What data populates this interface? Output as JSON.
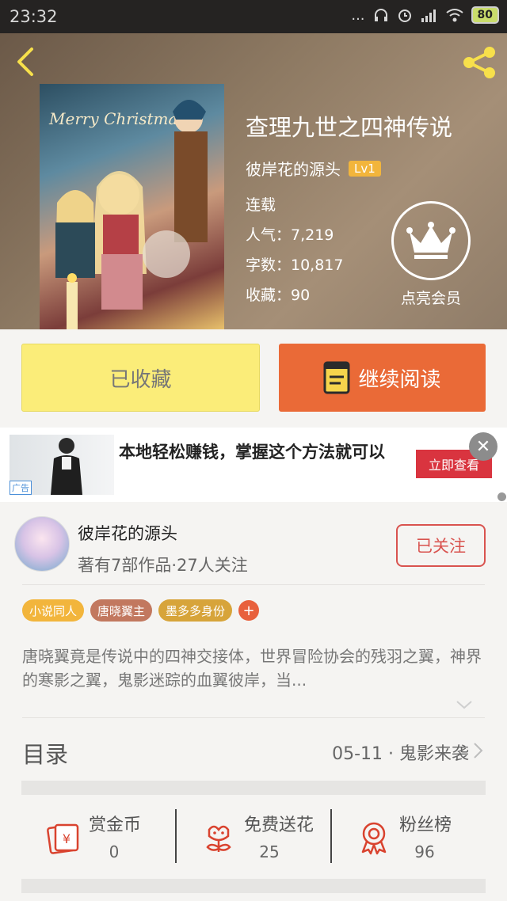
{
  "status_bar": {
    "time": "23:32",
    "dots": "...",
    "battery": "80"
  },
  "book": {
    "title": "查理九世之四神传说",
    "author": "彼岸花的源头",
    "author_level": "Lv1",
    "status": "连载",
    "popularity": "人气：7,219",
    "word_count": "字数：10,817",
    "favorites": "收藏：90",
    "cover_text": "Merry Christmas"
  },
  "vip": {
    "label": "点亮会员"
  },
  "actions": {
    "favorited_label": "已收藏",
    "continue_label": "继续阅读"
  },
  "ad": {
    "text": "本地轻松赚钱，掌握这个方法就可以",
    "cta": "立即查看",
    "badge": "广告",
    "close": "✕"
  },
  "author_card": {
    "name": "彼岸花的源头",
    "stats": "著有7部作品·27人关注",
    "follow_label": "已关注"
  },
  "tags": [
    {
      "label": "小说同人",
      "color": "#f2b53c"
    },
    {
      "label": "唐晓翼主",
      "color": "#c2785f"
    },
    {
      "label": "墨多多身份",
      "color": "#d7a43a"
    }
  ],
  "tag_add": "+",
  "description": "唐晓翼竟是传说中的四神交接体，世界冒险协会的残羽之翼，神界的寒影之翼，鬼影迷踪的血翼彼岸，当...",
  "toc": {
    "label": "目录",
    "latest": "05-11 · 鬼影来袭"
  },
  "stats": [
    {
      "label": "赏金币",
      "value": "0",
      "icon": "red-envelope-icon"
    },
    {
      "label": "免费送花",
      "value": "25",
      "icon": "flower-icon"
    },
    {
      "label": "粉丝榜",
      "value": "96",
      "icon": "medal-icon"
    }
  ],
  "colors": {
    "accent": "#ea6a37",
    "fav_button": "#fbed79",
    "follow": "#d9534f",
    "icon_red": "#d9432f"
  }
}
